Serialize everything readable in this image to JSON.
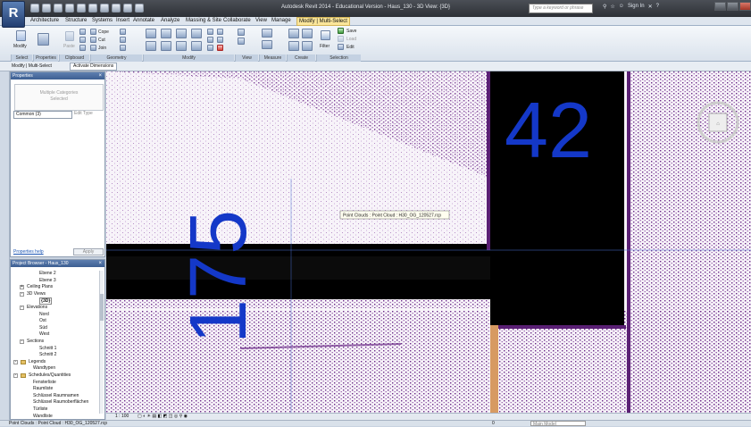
{
  "app": {
    "logo_letter": "R",
    "window_title": "Autodesk Revit 2014 - Educational Version -   Haus_130 - 3D View: {3D}",
    "search_placeholder": "Type a keyword or phrase",
    "sign_in": "Sign In",
    "help": "?"
  },
  "ribbon": {
    "tabs": [
      "Architecture",
      "Structure",
      "Systems",
      "Insert",
      "Annotate",
      "Analyze",
      "Massing & Site",
      "Collaborate",
      "View",
      "Manage",
      "Modify | Multi-Select"
    ],
    "active_tab": "Modify | Multi-Select",
    "modify_label": "Modify",
    "paste_label": "Paste",
    "cope_label": "Cope",
    "cut_label": "Cut",
    "join_label": "Join",
    "filter_label": "Filter",
    "save_label": "Save",
    "load_label": "Load",
    "edit_label": "Edit",
    "panels": [
      "Select",
      "Properties",
      "Clipboard",
      "Geometry",
      "Modify",
      "View",
      "Measure",
      "Create",
      "Selection"
    ]
  },
  "options_bar": {
    "mode": "Modify | Multi-Select",
    "activate_dimensions": "Activate Dimensions"
  },
  "properties": {
    "title": "Properties",
    "type_line1": "Multiple Categories",
    "type_line2": "Selected",
    "selector": "Common (3)",
    "edit_type": "Edit Type",
    "help_link": "Properties help",
    "apply": "Apply"
  },
  "project_browser": {
    "title": "Project Browser - Haus_130",
    "items": [
      {
        "label": "Ebene 2",
        "level": 3
      },
      {
        "label": "Ebene 3",
        "level": 3
      },
      {
        "label": "Ceiling Plans",
        "level": 1,
        "toggle": "+"
      },
      {
        "label": "3D Views",
        "level": 1,
        "toggle": "-"
      },
      {
        "label": "{3D}",
        "level": 3,
        "bold": true
      },
      {
        "label": "Elevations",
        "level": 1,
        "toggle": "-"
      },
      {
        "label": "Nord",
        "level": 3
      },
      {
        "label": "Ost",
        "level": 3
      },
      {
        "label": "Süd",
        "level": 3
      },
      {
        "label": "West",
        "level": 3
      },
      {
        "label": "Sections",
        "level": 1,
        "toggle": "-"
      },
      {
        "label": "Schnitt 1",
        "level": 3
      },
      {
        "label": "Schnitt 2",
        "level": 3
      },
      {
        "label": "Legends",
        "level": 0,
        "toggle": "-",
        "folder": true
      },
      {
        "label": "Wandtypen",
        "level": 2
      },
      {
        "label": "Schedules/Quantities",
        "level": 0,
        "toggle": "-",
        "folder": true
      },
      {
        "label": "Fensterliste",
        "level": 2
      },
      {
        "label": "Raumliste",
        "level": 2
      },
      {
        "label": "Schlüssel Raumnamen",
        "level": 2
      },
      {
        "label": "Schlüssel Raumoberflächen",
        "level": 2
      },
      {
        "label": "Türliste",
        "level": 2
      },
      {
        "label": "Wandliste",
        "level": 2
      }
    ]
  },
  "viewport": {
    "room_number": "42",
    "dimension_text": "175",
    "tooltip": "Point Clouds : Point Cloud : H30_OG_120527.rcp",
    "scale": "1 : 100",
    "cloud_color": "#6b2a87",
    "annotation_color": "#1438c8"
  },
  "status": {
    "text": "Point Clouds : Point Cloud : H30_OG_120527.rcp",
    "zero": "0",
    "model": "Main Model"
  }
}
